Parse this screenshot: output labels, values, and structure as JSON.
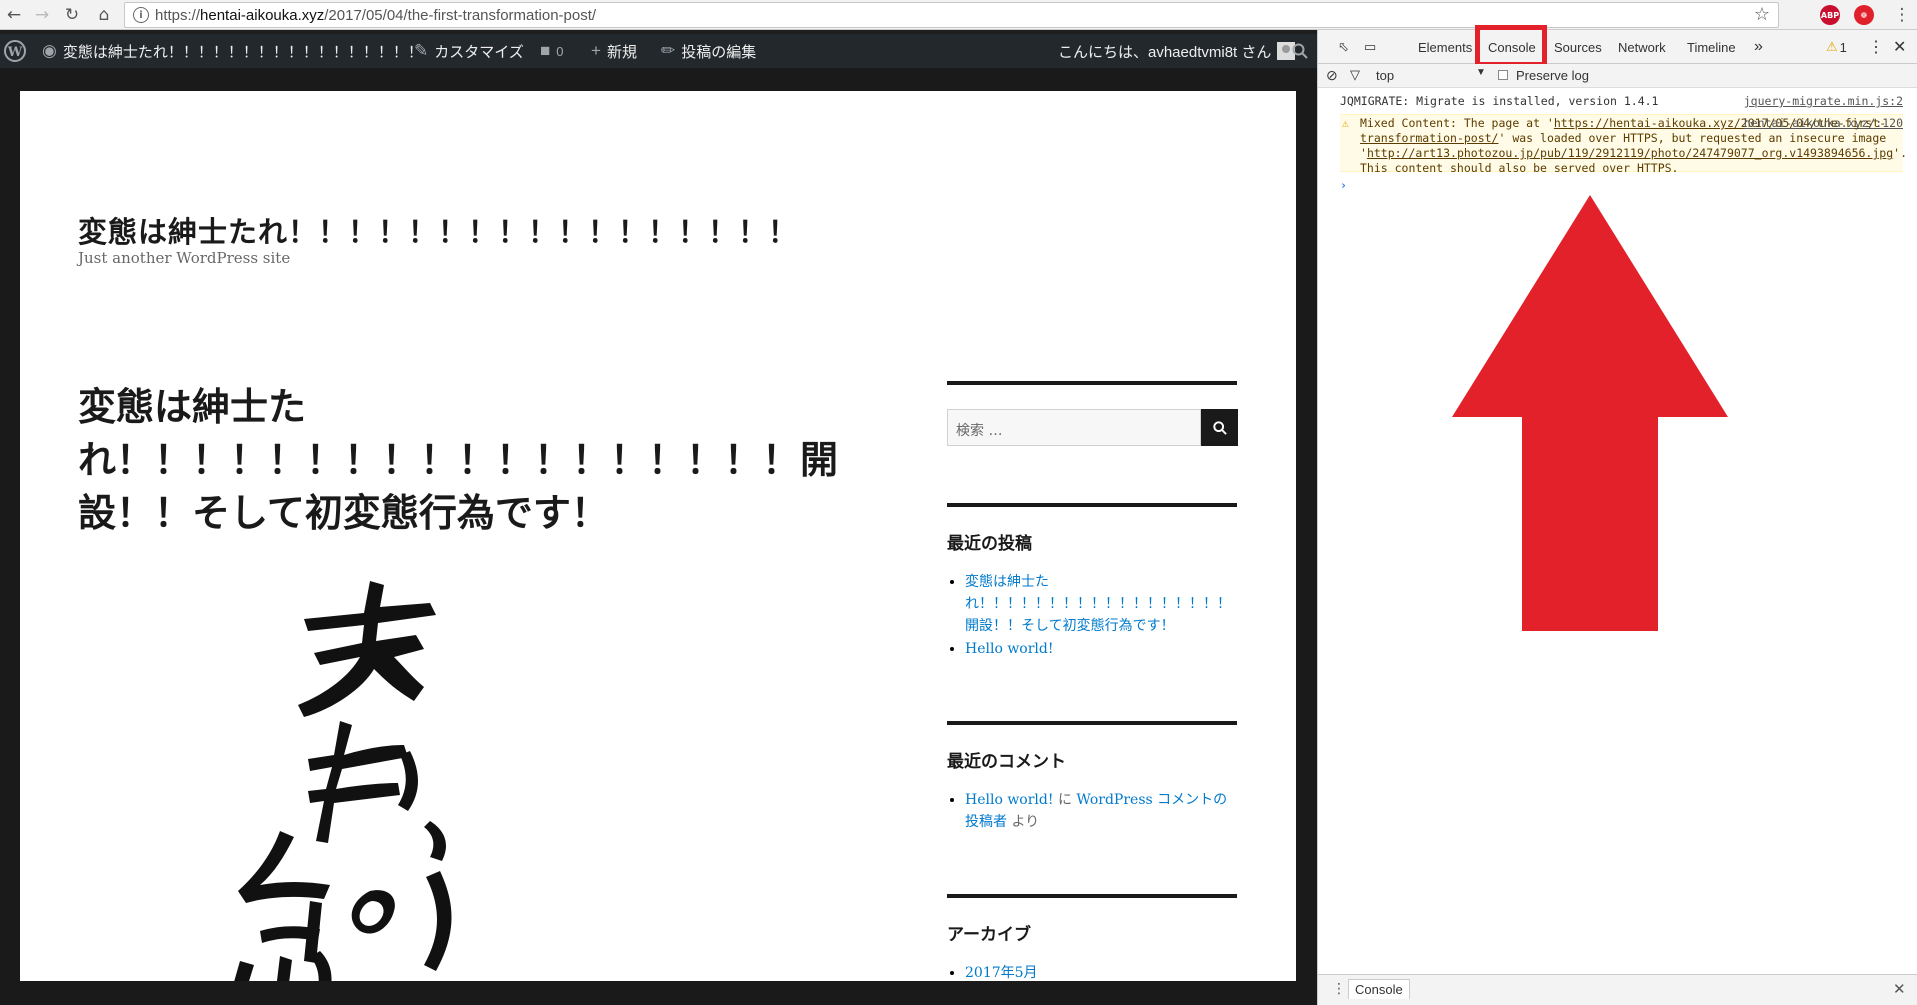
{
  "browser": {
    "url_prefix": "https://",
    "url_host": "hentai-aikouka.xyz",
    "url_path": "/2017/05/04/the-first-transformation-post/",
    "ext_abp": "ABP"
  },
  "admin_bar": {
    "site_name": "変態は紳士たれ！！！！！！！！！！！！！！！！！",
    "customize": "カスタマイズ",
    "comments_count": "0",
    "new": "新規",
    "edit_post": "投稿の編集",
    "greeting": "こんにちは、avhaedtvmi8t さん"
  },
  "site": {
    "title": "変態は紳士たれ！！！！！！！！！！！！！！！！！",
    "tagline": "Just another WordPress site"
  },
  "post": {
    "title": "変態は紳士たれ！！！！！！！！！！！！！！！！！！開設！！そして初変態行為です！"
  },
  "sidebar": {
    "search_placeholder": "検索 …",
    "recent_posts_title": "最近の投稿",
    "recent_posts": [
      "変態は紳士たれ！！！！！！！！！！！！！！！！！！開設！！そして初変態行為です！",
      "Hello world!"
    ],
    "recent_comments_title": "最近のコメント",
    "comment_post": "Hello world!",
    "comment_on": "に",
    "comment_author": "WordPress コメントの投稿者",
    "comment_by": "より",
    "archives_title": "アーカイブ",
    "archive_item": "2017年5月"
  },
  "devtools": {
    "tabs": [
      "Elements",
      "Console",
      "Sources",
      "Network",
      "Timeline"
    ],
    "active_tab": "Console",
    "warning_count": "1",
    "context": "top",
    "preserve_log": "Preserve log",
    "messages": {
      "jqmigrate": "JQMIGRATE: Migrate is installed, version 1.4.1",
      "jqmigrate_src": "jquery-migrate.min.js:2",
      "warn_src": "hentai-aikouka.xyz/:120",
      "warn_part1": "Mixed Content: The page at '",
      "warn_link1": "https://hentai-aikouka.xyz/2017/05/04/the-first-transformation-post/",
      "warn_part2": "' was loaded over HTTPS, but requested an insecure image '",
      "warn_link2": "http://art13.photozou.jp/pub/119/2912119/photo/247479077_org.v1493894656.jpg",
      "warn_part3": "'. This content should also be served over HTTPS."
    },
    "drawer_tab": "Console"
  },
  "colors": {
    "highlight": "#e3212b",
    "admin_bar": "#23282d",
    "link": "#007acc"
  }
}
